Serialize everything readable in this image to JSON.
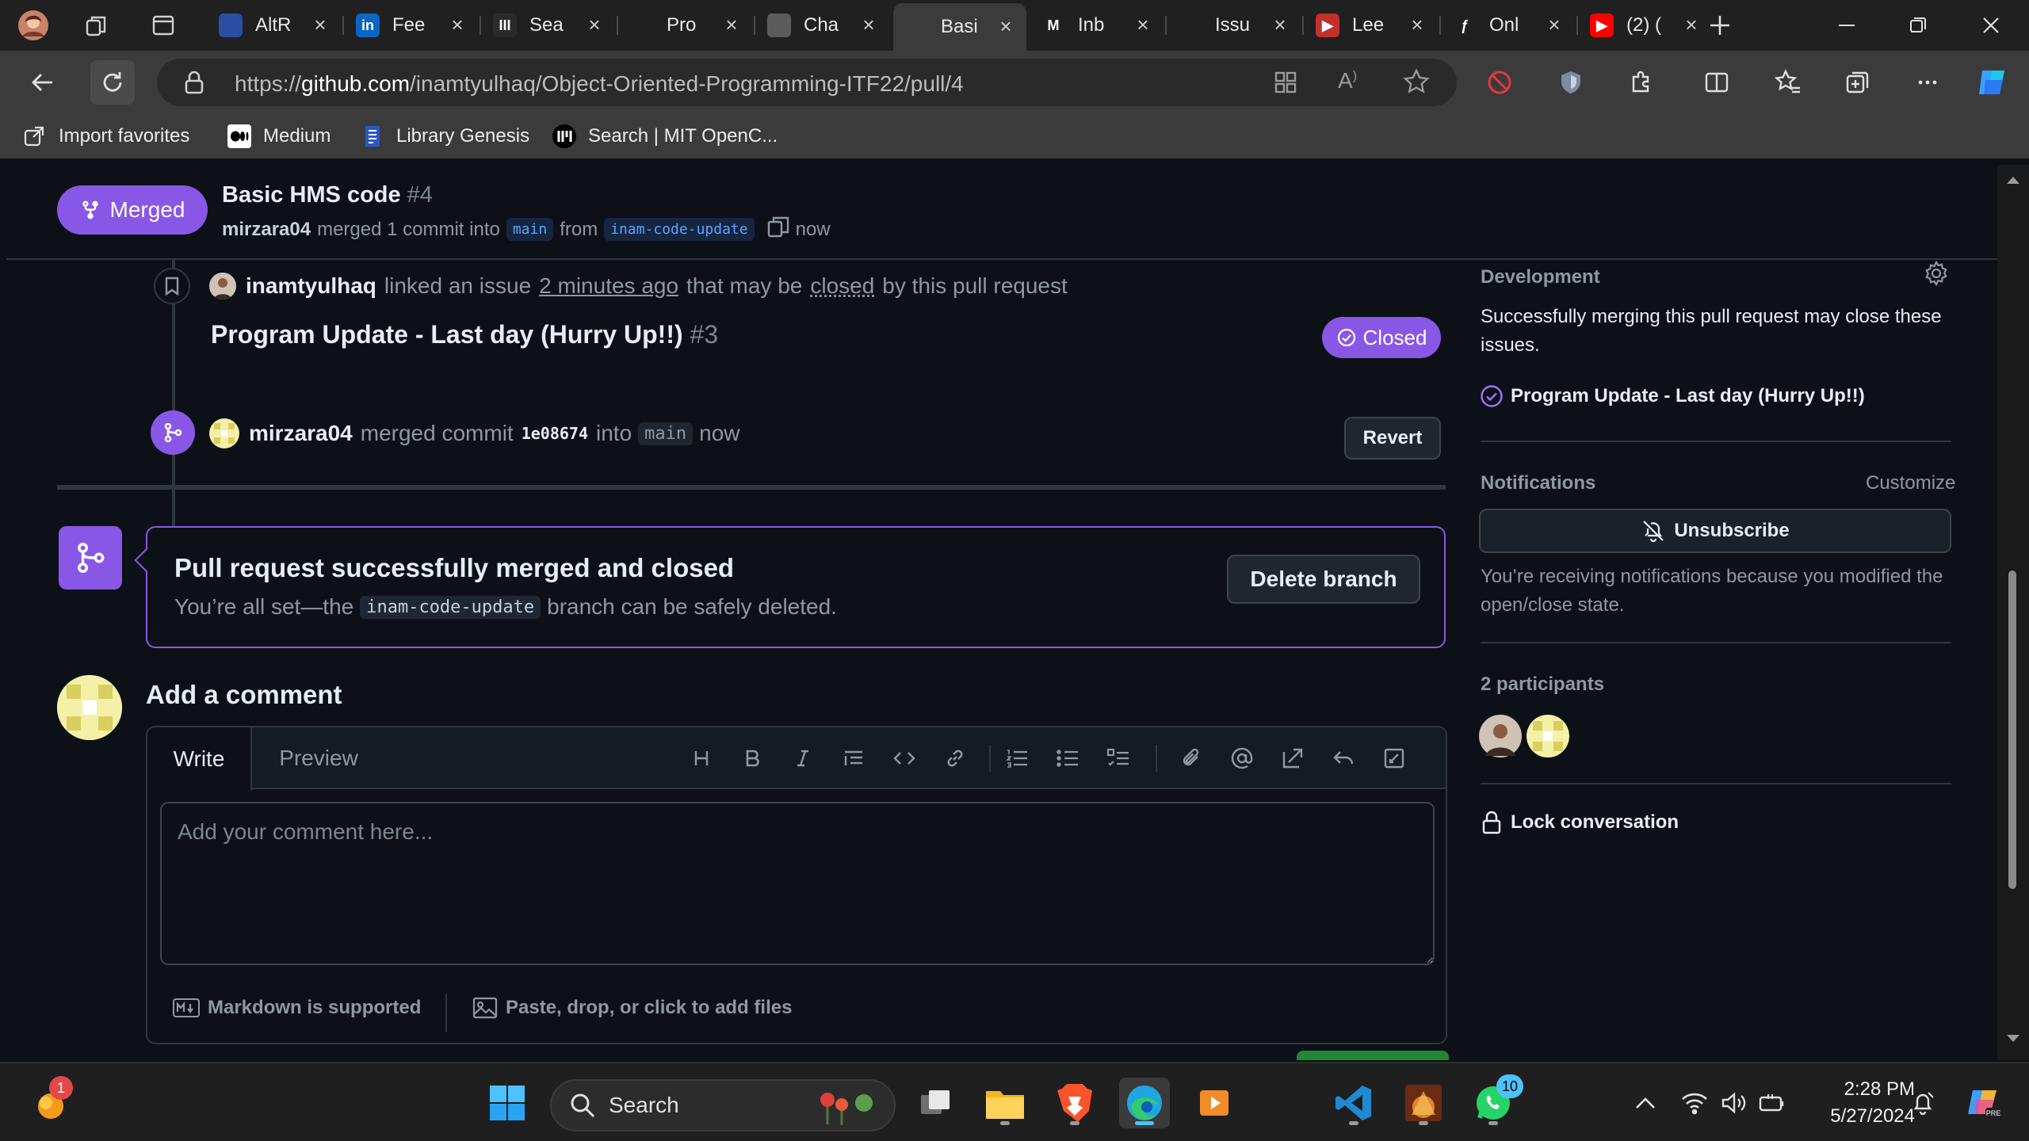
{
  "browser": {
    "tabs": [
      {
        "title": "AltR",
        "fav_color": "#2b4ea2",
        "fav_glyph": ""
      },
      {
        "title": "Fee",
        "fav_color": "#0a66c2",
        "fav_glyph": "in"
      },
      {
        "title": "Sea",
        "fav_color": "#2a2a2a",
        "fav_glyph": "III"
      },
      {
        "title": "Pro",
        "fav_color": "#202020",
        "fav_glyph": ""
      },
      {
        "title": "Cha",
        "fav_color": "#5c5c5c",
        "fav_glyph": ""
      },
      {
        "title": "Basi",
        "fav_color": "#3b3b3b",
        "fav_glyph": ""
      },
      {
        "title": "Inb",
        "fav_color": "#202020",
        "fav_glyph": "M"
      },
      {
        "title": "Issu",
        "fav_color": "#202020",
        "fav_glyph": ""
      },
      {
        "title": "Lee",
        "fav_color": "#c4302b",
        "fav_glyph": "▶"
      },
      {
        "title": "Onl",
        "fav_color": "#202020",
        "fav_glyph": "ƒ"
      },
      {
        "title": "(2) (",
        "fav_color": "#ff0000",
        "fav_glyph": "▶"
      }
    ],
    "address": {
      "prefix": "https://",
      "host": "github.com",
      "path": "/inamtyulhaq/Object-Oriented-Programming-ITF22/pull/4"
    },
    "favorites": [
      {
        "label": "Import favorites",
        "icon": "import-icon"
      },
      {
        "label": "Medium",
        "icon": "medium-icon"
      },
      {
        "label": "Library Genesis",
        "icon": "book-icon"
      },
      {
        "label": "Search | MIT OpenC...",
        "icon": "mit-icon"
      }
    ]
  },
  "pr": {
    "state": "Merged",
    "title": "Basic HMS code",
    "number": "#4",
    "meta": {
      "user": "mirzara04",
      "action": "merged 1 commit into",
      "base": "main",
      "from_word": "from",
      "head": "inam-code-update",
      "time": "now"
    }
  },
  "timeline": {
    "linked": {
      "user": "inamtyulhaq",
      "text1": "linked an issue",
      "when": "2 minutes ago",
      "text2": "that may be",
      "closed_word": "closed",
      "text3": "by this pull request"
    },
    "issue": {
      "title": "Program Update - Last day (Hurry Up!!)",
      "number": "#3",
      "state": "Closed"
    },
    "merged": {
      "user": "mirzara04",
      "text": "merged commit",
      "sha": "1e08674",
      "into": "into",
      "branch": "main",
      "time": "now",
      "revert": "Revert"
    }
  },
  "merge_box": {
    "title": "Pull request successfully merged and closed",
    "desc_before": "You’re all set—the",
    "branch": "inam-code-update",
    "desc_after": "branch can be safely deleted.",
    "button": "Delete branch"
  },
  "composer": {
    "title": "Add a comment",
    "tab_write": "Write",
    "tab_preview": "Preview",
    "placeholder": "Add your comment here...",
    "markdown": "Markdown is supported",
    "attach": "Paste, drop, or click to add files"
  },
  "sidebar": {
    "development": {
      "heading": "Development",
      "text": "Successfully merging this pull request may close these issues.",
      "issue": "Program Update - Last day (Hurry Up!!)"
    },
    "notifications": {
      "heading": "Notifications",
      "customize": "Customize",
      "button": "Unsubscribe",
      "reason": "You’re receiving notifications because you modified the open/close state."
    },
    "participants": {
      "heading": "2 participants"
    },
    "lock": "Lock conversation"
  },
  "taskbar": {
    "search": "Search",
    "notif_badge": "1",
    "whatsapp_badge": "10",
    "time": "2:28 PM",
    "date": "5/27/2024"
  }
}
